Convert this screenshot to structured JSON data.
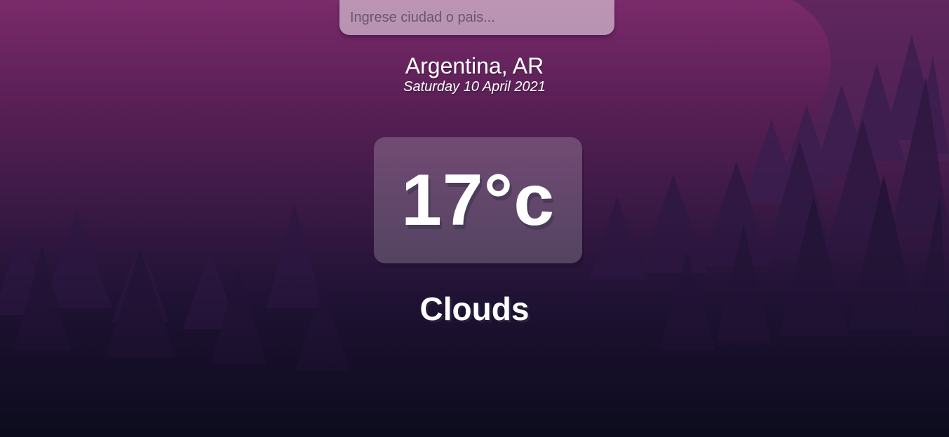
{
  "search": {
    "placeholder": "Ingrese ciudad o pais...",
    "value": ""
  },
  "location": {
    "name": "Argentina, AR",
    "date": "Saturday 10 April 2021"
  },
  "weather": {
    "temperature": "17°c",
    "condition": "Clouds"
  },
  "colors": {
    "background_top": "#7a2a6a",
    "background_bottom": "#0c0b1d",
    "text": "#ffffff"
  }
}
